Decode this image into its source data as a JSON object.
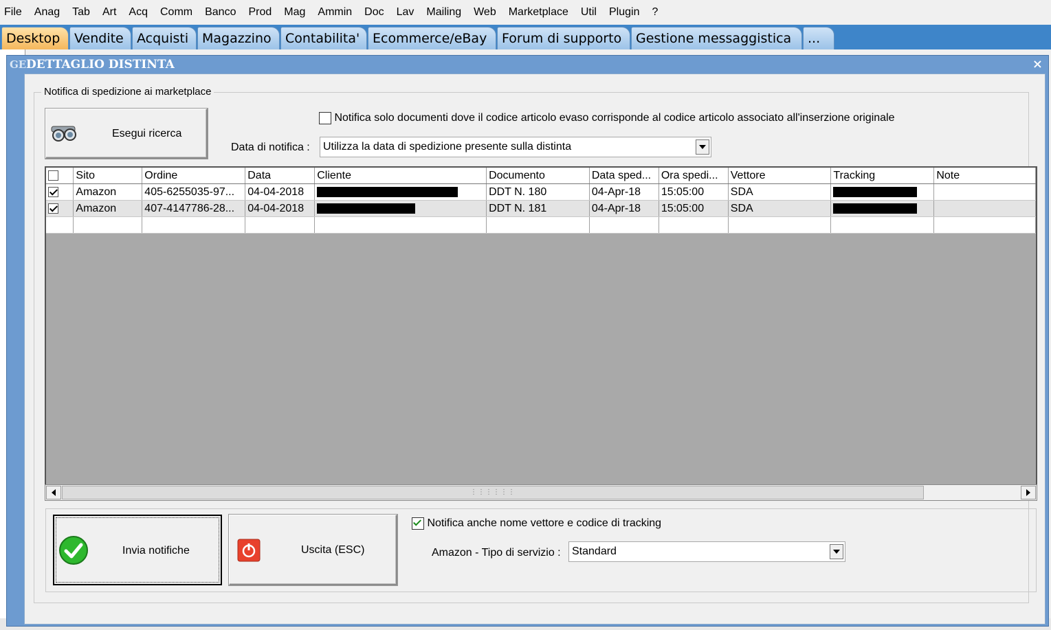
{
  "menu": [
    "File",
    "Anag",
    "Tab",
    "Art",
    "Acq",
    "Comm",
    "Banco",
    "Prod",
    "Mag",
    "Ammin",
    "Doc",
    "Lav",
    "Mailing",
    "Web",
    "Marketplace",
    "Util",
    "Plugin",
    "?"
  ],
  "tabs": [
    "Desktop",
    "Vendite",
    "Acquisti",
    "Magazzino",
    "Contabilita'",
    "Ecommerce/eBay",
    "Forum di supporto",
    "Gestione messaggistica",
    "..."
  ],
  "dialog": {
    "title_prefix": "GE",
    "title": "DETTAGLIO DISTINTA",
    "close": "×",
    "group_legend": "Notifica di spedizione ai marketplace",
    "search_button": "Esegui ricerca",
    "only_matching_label": "Notifica solo documenti dove il codice articolo evaso corrisponde al codice articolo associato all'inserzione originale",
    "only_matching_checked": false,
    "date_label": "Data di notifica :",
    "date_value": "Utilizza la data di spedizione presente sulla distinta",
    "send_button": "Invia notifiche",
    "exit_button": "Uscita (ESC)",
    "notify_carrier_label": "Notifica anche nome vettore e codice di tracking",
    "notify_carrier_checked": true,
    "service_label": "Amazon - Tipo di servizio :",
    "service_value": "Standard"
  },
  "grid": {
    "columns": [
      "Sito",
      "Ordine",
      "Data",
      "Cliente",
      "Documento",
      "Data sped...",
      "Ora spedi...",
      "Vettore",
      "Tracking",
      "Note"
    ],
    "rows": [
      {
        "checked": true,
        "sito": "Amazon",
        "ordine": "405-6255035-97...",
        "data": "04-04-2018",
        "cliente": "",
        "documento": "DDT N. 180",
        "data_sped": "04-Apr-18",
        "ora": "15:05:00",
        "vettore": "SDA",
        "tracking": "",
        "note": ""
      },
      {
        "checked": true,
        "sito": "Amazon",
        "ordine": "407-4147786-28...",
        "data": "04-04-2018",
        "cliente": "",
        "documento": "DDT N. 181",
        "data_sped": "04-Apr-18",
        "ora": "15:05:00",
        "vettore": "SDA",
        "tracking": "",
        "note": ""
      }
    ]
  },
  "colors": {
    "tabbar": "#3e85c9",
    "active_tab": "#f5b75c",
    "dialog_title": "#6d9bd0",
    "grid_empty": "#a9a9a9"
  }
}
